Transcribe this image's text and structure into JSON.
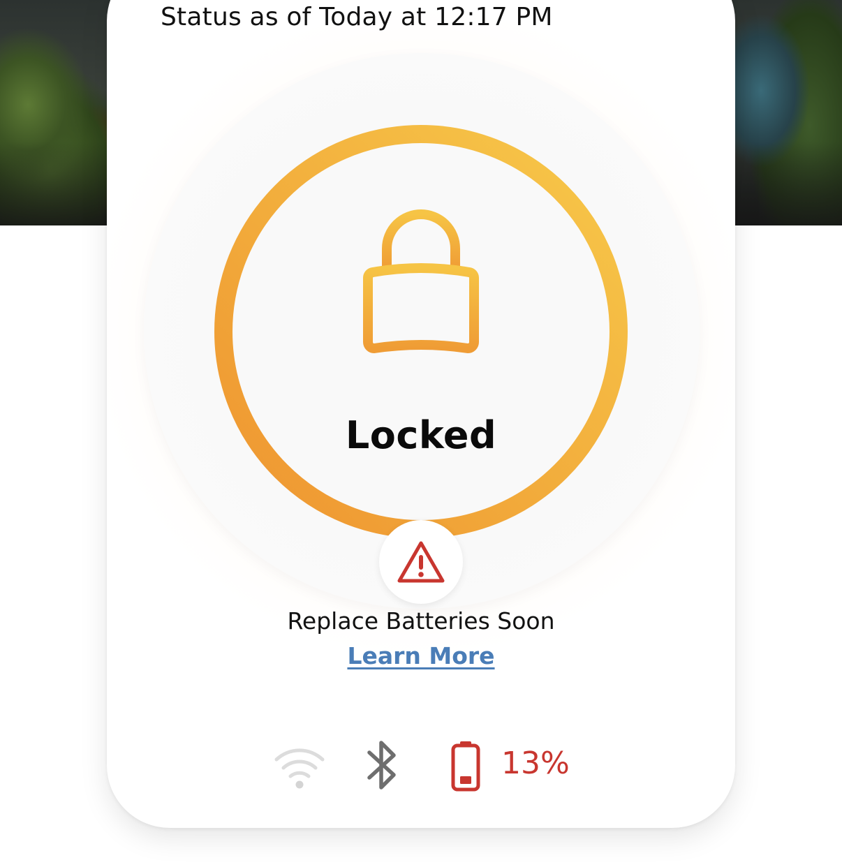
{
  "status": {
    "timestamp_text": "Status as of Today at 12:17 PM",
    "lock_state": "Locked"
  },
  "alert": {
    "message": "Replace Batteries Soon",
    "link_label": "Learn More",
    "icon": "warning-icon"
  },
  "connectivity": {
    "wifi_icon": "wifi-icon",
    "wifi_state": "disabled",
    "bluetooth_icon": "bluetooth-icon",
    "battery_icon": "battery-low-icon",
    "battery_percent_text": "13%",
    "battery_level": 0.13
  },
  "colors": {
    "ring_start": "#f6c445",
    "ring_end": "#ee9930",
    "alert_red": "#c8362f",
    "link_blue": "#4a7db7",
    "wifi_gray": "#d8d8d8",
    "bluetooth_gray": "#6e6e6e"
  }
}
